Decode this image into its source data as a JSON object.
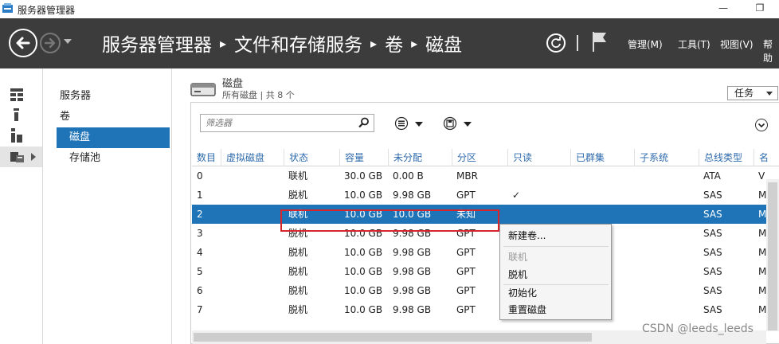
{
  "window": {
    "title": "服务器管理器",
    "minimize_glyph": "—",
    "restore_glyph": "❐"
  },
  "header": {
    "breadcrumbs": [
      "服务器管理器",
      "文件和存储服务",
      "卷",
      "磁盘"
    ],
    "separator": "▸",
    "menus": [
      "管理(M)",
      "工具(T)",
      "视图(V)",
      "帮助"
    ]
  },
  "icon_strip": [
    "dashboard-icon",
    "local-server-icon",
    "all-servers-icon",
    "file-storage-icon"
  ],
  "nav": {
    "items": [
      "服务器",
      "卷",
      "磁盘",
      "存储池"
    ],
    "selected": "磁盘"
  },
  "section": {
    "title": "磁盘",
    "subtitle": "所有磁盘 | 共 8 个",
    "tasks_label": "任务"
  },
  "filter": {
    "placeholder": "筛选器"
  },
  "table": {
    "columns": [
      "数目",
      "虚拟磁盘",
      "状态",
      "容量",
      "未分配",
      "分区",
      "只读",
      "已群集",
      "子系统",
      "总线类型",
      "名"
    ],
    "rows": [
      [
        "0",
        "",
        "联机",
        "30.0 GB",
        "0.00 B",
        "MBR",
        "",
        "",
        "",
        "ATA",
        "V"
      ],
      [
        "1",
        "",
        "脱机",
        "10.0 GB",
        "9.98 GB",
        "GPT",
        "✓",
        "",
        "",
        "SAS",
        "M"
      ],
      [
        "2",
        "",
        "联机",
        "10.0 GB",
        "10.0 GB",
        "未知",
        "",
        "",
        "",
        "SAS",
        "M"
      ],
      [
        "3",
        "",
        "脱机",
        "10.0 GB",
        "9.98 GB",
        "GPT",
        "",
        "",
        "",
        "SAS",
        "M"
      ],
      [
        "4",
        "",
        "脱机",
        "10.0 GB",
        "9.98 GB",
        "GPT",
        "",
        "",
        "",
        "SAS",
        "M"
      ],
      [
        "5",
        "",
        "脱机",
        "10.0 GB",
        "9.98 GB",
        "GPT",
        "",
        "",
        "",
        "SAS",
        "M"
      ],
      [
        "6",
        "",
        "脱机",
        "10.0 GB",
        "9.98 GB",
        "GPT",
        "",
        "",
        "",
        "SAS",
        "M"
      ],
      [
        "7",
        "",
        "脱机",
        "10.0 GB",
        "9.98 GB",
        "GPT",
        "",
        "",
        "",
        "SAS",
        "M"
      ]
    ],
    "selected_row": "2"
  },
  "context_menu": {
    "items": [
      "新建卷...",
      "联机",
      "脱机",
      "初始化",
      "重置磁盘"
    ],
    "disabled": [
      "联机"
    ]
  },
  "watermark": "CSDN @leeds_leeds",
  "colors": {
    "header_bg": "#3c3c3c",
    "accent": "#1f73b7",
    "highlight_red": "#d6262d"
  }
}
